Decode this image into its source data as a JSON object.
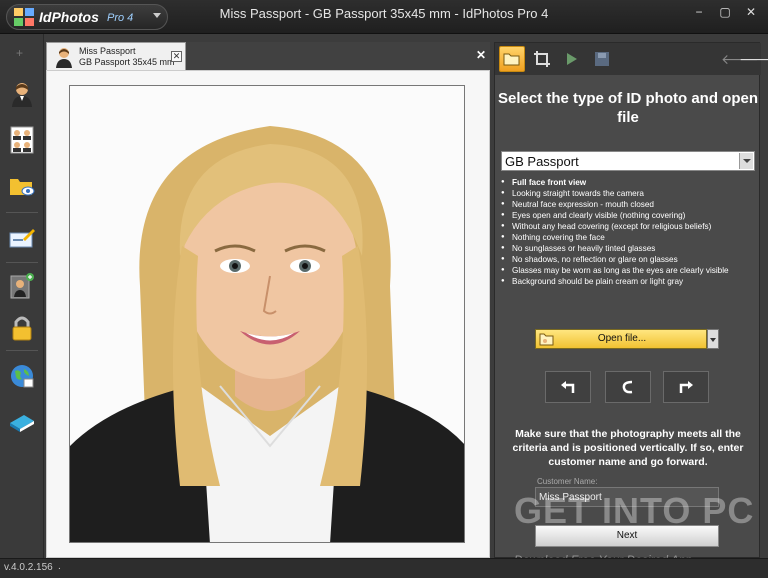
{
  "app": {
    "name": "IdPhotos",
    "version_badge": "Pro 4",
    "window_title": "Miss Passport - GB Passport 35x45 mm - IdPhotos Pro 4"
  },
  "window_controls": {
    "minimize": "−",
    "maximize": "▢",
    "close": "✕"
  },
  "left_toolbar": {
    "plus": "+",
    "tools": [
      "single-portrait-icon",
      "multi-portrait-icon",
      "folder-view-icon",
      "edit-card-icon",
      "person-add-icon",
      "lock-icon",
      "globe-icon",
      "book-icon"
    ]
  },
  "document_tab": {
    "name": "Miss Passport",
    "format": "GB Passport 35x45 mm",
    "close": "✕"
  },
  "doc_close": "✕",
  "right_panel": {
    "heading": "Select the type of ID photo and open file",
    "document_type": "GB Passport",
    "criteria": [
      "Full face front view",
      "Looking straight towards the camera",
      "Neutral face expression - mouth closed",
      "Eyes open and clearly visible (nothing covering)",
      "Without any head covering (except for religious beliefs)",
      "Nothing covering the face",
      "No sunglasses or heavily tinted glasses",
      "No shadows, no reflection or glare on glasses",
      "Glasses may be worn as long as the eyes are clearly visible",
      "Background should be plain cream or light gray"
    ],
    "open_file_label": "Open file...",
    "instruction": "Make sure that the photography meets all the criteria and is positioned vertically. If so, enter customer name and  go forward.",
    "customer_name_label": "Customer Name:",
    "customer_name_value": "Miss Passport",
    "next_label": "Next",
    "nav_back": "🡐",
    "nav_forward": "🡒"
  },
  "watermark": {
    "text": "GET INTO PC",
    "subtext": "Download Free Your Desired App"
  },
  "status": {
    "version": "v.4.0.2.156",
    "extra": "."
  },
  "colors": {
    "accent_orange": "#f0a020",
    "button_yellow": "#f1c232",
    "panel": "#4a4a4a"
  }
}
